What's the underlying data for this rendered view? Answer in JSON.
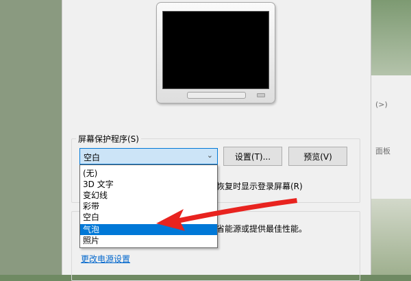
{
  "screensaver": {
    "group_label": "屏幕保护程序(S)",
    "selected": "空白",
    "settings_button": "设置(T)...",
    "preview_button": "预览(V)",
    "resume_text": "恢复时显示登录屏幕(R)",
    "options": [
      "(无)",
      "3D 文字",
      "变幻线",
      "彩带",
      "空白",
      "气泡",
      "照片"
    ],
    "highlighted": "气泡"
  },
  "power": {
    "description_fragment": "省能源或提供最佳性能。",
    "link": "更改电源设置"
  },
  "background": {
    "right_text_1": "(>)",
    "right_text_2": "面板"
  },
  "annotation": {
    "color": "#e8231f"
  },
  "colors": {
    "accent": "#0078d7",
    "selection": "#cce4f7"
  }
}
